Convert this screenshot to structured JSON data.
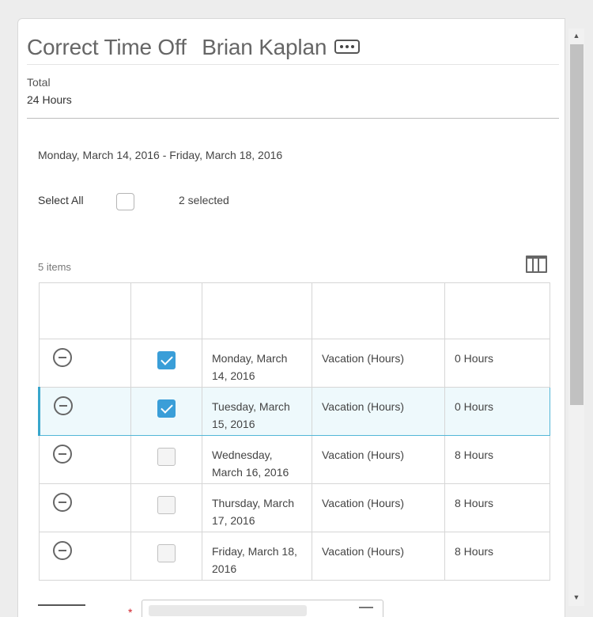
{
  "header": {
    "title": "Correct Time Off",
    "subtitle": "Brian Kaplan",
    "related_actions_icon": "ellipsis-icon"
  },
  "summary": {
    "total_label": "Total",
    "total_value": "24 Hours"
  },
  "date_range": "Monday, March 14, 2016 - Friday, March 18, 2016",
  "selection": {
    "select_all_label": "Select All",
    "select_all_checked": false,
    "selected_count": "2 selected"
  },
  "grid": {
    "items_count": "5 items",
    "column_chooser_icon": "columns-icon",
    "columns": [
      "",
      "",
      "",
      "",
      ""
    ],
    "rows": [
      {
        "date": "Monday, March 14, 2016",
        "type": "Vacation (Hours)",
        "hours": "0 Hours",
        "checked": true,
        "highlighted": false
      },
      {
        "date": "Tuesday, March 15, 2016",
        "type": "Vacation (Hours)",
        "hours": "0 Hours",
        "checked": true,
        "highlighted": true
      },
      {
        "date": "Wednesday, March 16, 2016",
        "type": "Vacation (Hours)",
        "hours": "8 Hours",
        "checked": false,
        "highlighted": false
      },
      {
        "date": "Thursday, March 17, 2016",
        "type": "Vacation (Hours)",
        "hours": "8 Hours",
        "checked": false,
        "highlighted": false
      },
      {
        "date": "Friday, March 18, 2016",
        "type": "Vacation (Hours)",
        "hours": "8 Hours",
        "checked": false,
        "highlighted": false
      }
    ]
  },
  "colors": {
    "accent": "#3a9ed8",
    "highlight_row_bg": "#eef9fc",
    "required": "#d0212a"
  }
}
